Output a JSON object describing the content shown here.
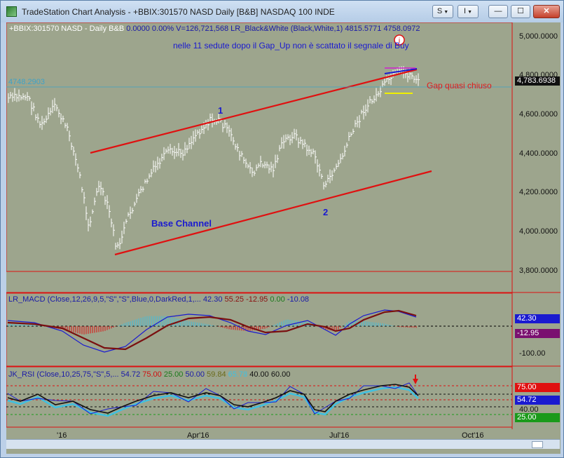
{
  "window": {
    "title": "TradeStation Chart Analysis - +BBIX:301570 NASD Daily [B&B] NASDAQ 100 INDE",
    "buttons": {
      "s": "S",
      "i": "I",
      "minimize": "—",
      "maximize": "☐",
      "close": "✕"
    }
  },
  "price_panel": {
    "header": "+BBIX:301570 NASD - Daily  B&B",
    "header_vals": "0.0000  0.00%  V=126,721,568  LR_Black&White (Black,White,1)  4815.5771  4758.0972",
    "annotation": "nelle 11 sedute dopo il Gap_Up non è scattato il segnale di Buy",
    "gap_label": "Gap quasi chiuso",
    "base_channel_label": "Base Channel",
    "wave1": "1",
    "wave2": "2",
    "marker": "i",
    "price_line_label": "4748.2903",
    "last_price": "4,783.6938",
    "y_ticks": [
      "5,000.0000",
      "4,800.0000",
      "4,600.0000",
      "4,400.0000",
      "4,200.0000",
      "4,000.0000",
      "3,800.0000"
    ]
  },
  "macd_panel": {
    "header": "LR_MACD (Close,12,26,9,5,\"S\",\"S\",Blue,0,DarkRed,1,...",
    "v1": "42.30",
    "v2": "55.25",
    "v3": "-12.95",
    "v4": "0.00",
    "v5": "-10.08",
    "y_box1": "42.30",
    "y_box2": "-12.95",
    "y_tick_bottom": "-100.00"
  },
  "rsi_panel": {
    "header": "JK_RSI (Close,10,25,75,\"S\",5,...",
    "v1": "54.72",
    "v2": "75.00",
    "v3": "25.00",
    "v4": "50.00",
    "v5": "59.84",
    "v6": "65.78",
    "v7": "40.00",
    "v8": "60.00",
    "y_box_75": "75.00",
    "y_box_current": "54.72",
    "y_tick_40": "40.00",
    "y_box_25": "25.00"
  },
  "x_axis": [
    "'16",
    "Apr'16",
    "Jul'16",
    "Oct'16"
  ],
  "colors": {
    "channel": "#e01010",
    "background": "#9da58d",
    "bars": "#ffffff",
    "accent": "#1a1ad0"
  }
}
